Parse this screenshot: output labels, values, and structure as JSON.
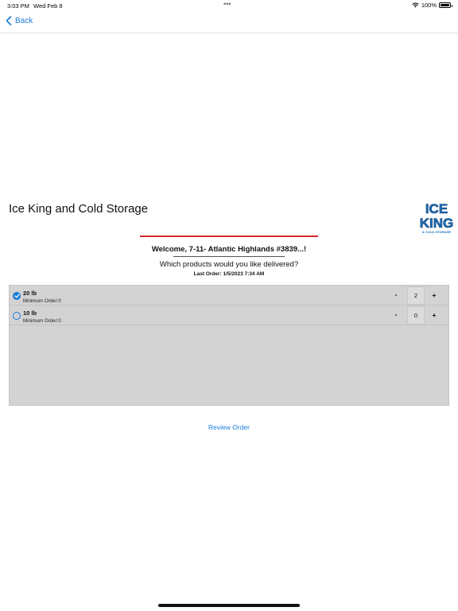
{
  "status_bar": {
    "time": "3:03 PM",
    "date": "Wed Feb 8",
    "dots": "•••",
    "battery": "100%"
  },
  "nav": {
    "back_label": "Back"
  },
  "header": {
    "title": "Ice King and Cold Storage",
    "logo_text_top": "ICE",
    "logo_text_bottom": "KING",
    "logo_subtext": "& COLD STORAGE"
  },
  "order": {
    "welcome": "Welcome, 7-11- Atlantic Highlands #3839...!",
    "question": "Which products would you like delivered?",
    "last_order": "Last Order: 1/5/2023 7:34 AM"
  },
  "products": [
    {
      "name": "20 lb",
      "min": "Minimum Order:0",
      "qty": "2",
      "selected": true,
      "minus": "-",
      "plus": "+"
    },
    {
      "name": "10 lb",
      "min": "Minimum Order:0",
      "qty": "0",
      "selected": false,
      "minus": "-",
      "plus": "+"
    }
  ],
  "actions": {
    "review_order": "Review Order"
  },
  "colors": {
    "accent": "#1a7bd9",
    "divider_red": "#d62828",
    "panel_gray": "#d3d3d3"
  }
}
